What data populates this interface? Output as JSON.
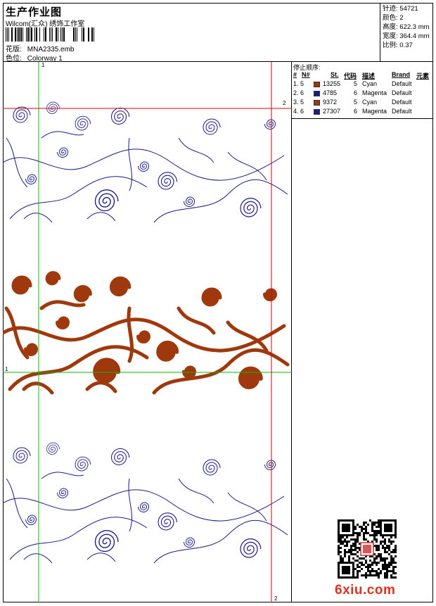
{
  "header": {
    "title": "生产作业图",
    "subtitle": "Wilcom(汇众) 绣饰工作室",
    "pattern_label": "花版:",
    "pattern_value": "MNA2335.emb",
    "colorway_label": "色位:",
    "colorway_value": "Colorway 1"
  },
  "stats": [
    {
      "label": "针迹:",
      "value": "54721"
    },
    {
      "label": "颜色:",
      "value": "2"
    },
    {
      "label": "高度:",
      "value": "622.3 mm"
    },
    {
      "label": "宽度:",
      "value": "364.4 mm"
    },
    {
      "label": "比例:",
      "value": "0.37"
    }
  ],
  "guides": {
    "top_left": "1",
    "left_mid": "1",
    "right_top": "2",
    "bottom_right": "2"
  },
  "stop_sequence": {
    "title": "停止顺序:",
    "headers": {
      "num": "#",
      "n": "N#",
      "st": "St.",
      "code": "代码",
      "desc": "描述",
      "brand": "Brand",
      "element": "元素"
    },
    "rows": [
      {
        "num": "1.",
        "n": "5",
        "st": "13255",
        "code": "5",
        "desc": "Cyan",
        "brand": "Default",
        "color": "#a0380e"
      },
      {
        "num": "2.",
        "n": "6",
        "st": "4785",
        "code": "6",
        "desc": "Magenta",
        "brand": "Default",
        "color": "#1a1a8c"
      },
      {
        "num": "3.",
        "n": "5",
        "st": "9372",
        "code": "5",
        "desc": "Cyan",
        "brand": "Default",
        "color": "#a0380e"
      },
      {
        "num": "4.",
        "n": "6",
        "st": "27307",
        "code": "6",
        "desc": "Magenta",
        "brand": "Default",
        "color": "#1a1a8c"
      }
    ]
  },
  "colors": {
    "outline_blue": "#1a1a8c",
    "fill_brown": "#a0380e",
    "guide_green": "#00c000",
    "guide_red": "#e00000",
    "watermark_red": "#e0301e"
  },
  "watermark": "6xiu.com"
}
